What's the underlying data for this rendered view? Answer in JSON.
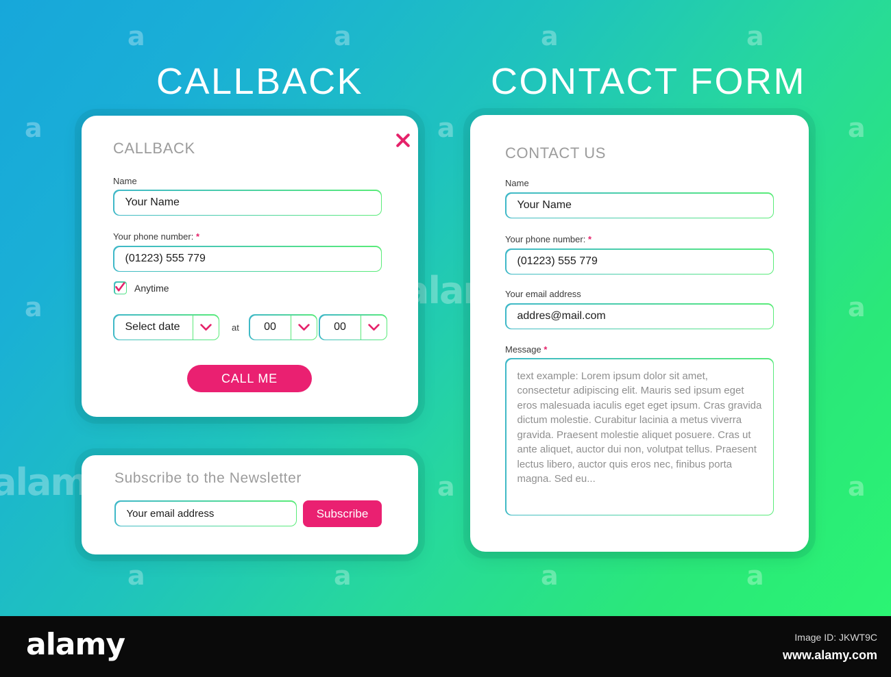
{
  "colors": {
    "bg_start": "#17a7da",
    "bg_end": "#2bf473",
    "accent_pink": "#ea2071",
    "border_teal": "#3fb8c8",
    "border_green": "#59ec78",
    "heading_grey": "#9c9c9c"
  },
  "headings": {
    "callback": "CALLBACK",
    "contact": "CONTACT FORM"
  },
  "callback_card": {
    "title": "CALLBACK",
    "close_icon": "close-icon",
    "name_label": "Name",
    "name_value": "Your Name",
    "phone_label": "Your phone number:",
    "phone_required": "*",
    "phone_value": "(01223)  555 779",
    "anytime_label": "Anytime",
    "anytime_checked": true,
    "date_value": "Select date",
    "at_label": "at",
    "hour_value": "00",
    "minute_value": "00",
    "chevron_icon": "chevron-down-icon",
    "submit_label": "CALL ME"
  },
  "newsletter_card": {
    "title": "Subscribe to the Newsletter",
    "email_value": "Your email address",
    "submit_label": "Subscribe"
  },
  "contact_card": {
    "title": "CONTACT US",
    "name_label": "Name",
    "name_value": "Your Name",
    "phone_label": "Your phone number:",
    "phone_required": "*",
    "phone_value": "(01223)  555 779",
    "email_label": "Your email address",
    "email_value": "addres@mail.com",
    "message_label": "Message",
    "message_required": "*",
    "message_value": "text example:\nLorem ipsum dolor sit amet, consectetur adipiscing elit. Mauris sed ipsum eget eros malesuada iaculis eget eget ipsum. Cras gravida dictum molestie. Curabitur lacinia a metus viverra gravida. Praesent molestie aliquet posuere. Cras ut ante aliquet, auctor dui non, volutpat tellus. Praesent lectus libero, auctor quis eros nec, finibus porta magna. Sed eu..."
  },
  "watermark": {
    "letter": "a",
    "word": "alamy"
  },
  "footer": {
    "logo": "alamy",
    "image_id": "Image ID: JKWT9C",
    "url": "www.alamy.com"
  }
}
